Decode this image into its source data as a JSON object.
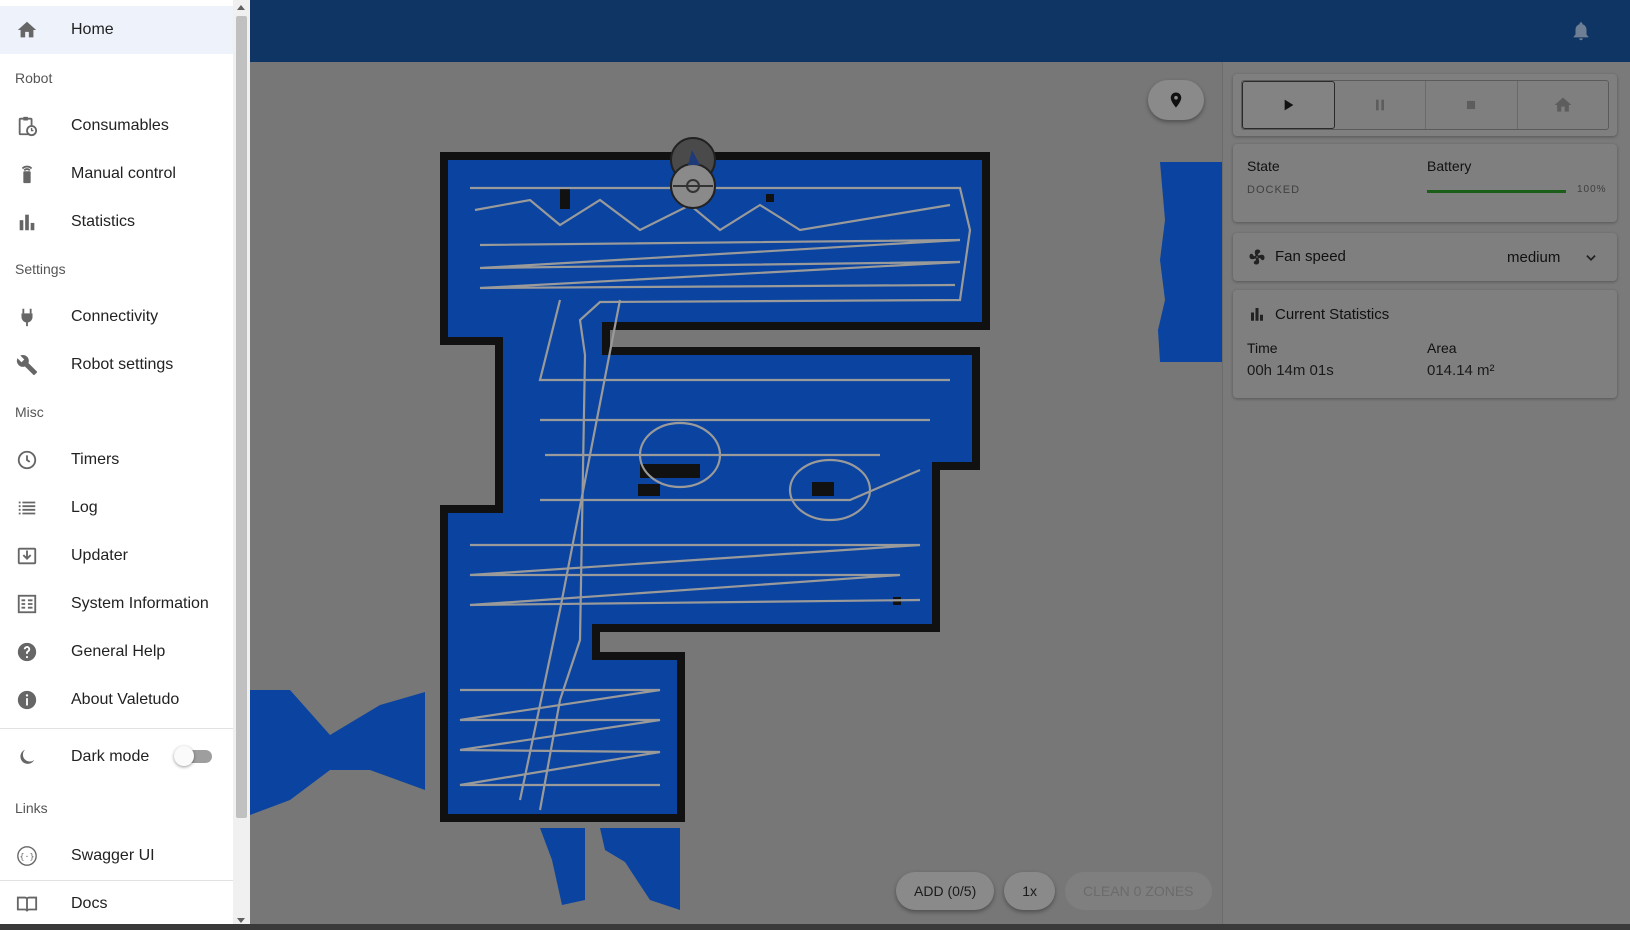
{
  "drawer": {
    "items": [
      {
        "label": "Home",
        "icon": "home-icon"
      },
      {
        "label": "Consumables",
        "icon": "consumables-icon"
      },
      {
        "label": "Manual control",
        "icon": "remote-icon"
      },
      {
        "label": "Statistics",
        "icon": "bar-chart-icon"
      },
      {
        "label": "Connectivity",
        "icon": "plug-icon"
      },
      {
        "label": "Robot settings",
        "icon": "wrench-icon"
      },
      {
        "label": "Timers",
        "icon": "clock-icon"
      },
      {
        "label": "Log",
        "icon": "list-icon"
      },
      {
        "label": "Updater",
        "icon": "download-icon"
      },
      {
        "label": "System Information",
        "icon": "system-info-icon"
      },
      {
        "label": "General Help",
        "icon": "help-icon"
      },
      {
        "label": "About Valetudo",
        "icon": "info-icon"
      },
      {
        "label": "Dark mode",
        "icon": "moon-icon"
      },
      {
        "label": "Swagger UI",
        "icon": "api-icon"
      },
      {
        "label": "Docs",
        "icon": "book-icon"
      }
    ],
    "sections": {
      "robot": "Robot",
      "settings": "Settings",
      "misc": "Misc",
      "links": "Links"
    },
    "dark_mode_on": false
  },
  "panel": {
    "state_label": "State",
    "state_value": "DOCKED",
    "battery_label": "Battery",
    "battery_value": "100%",
    "battery_level": 1.0,
    "fan_label": "Fan speed",
    "fan_value": "medium",
    "stats_title": "Current Statistics",
    "time_label": "Time",
    "time_value": "00h 14m 01s",
    "area_label": "Area",
    "area_value": "014.14 m²"
  },
  "map_controls": {
    "add_label": "ADD (0/5)",
    "iterations_label": "1x",
    "clean_label": "CLEAN 0 ZONES"
  },
  "colors": {
    "topbar": "#0e3563",
    "floor": "#0a44a0",
    "wall": "#111111",
    "path": "#9a9a9a",
    "battery": "#1a5e1a"
  }
}
